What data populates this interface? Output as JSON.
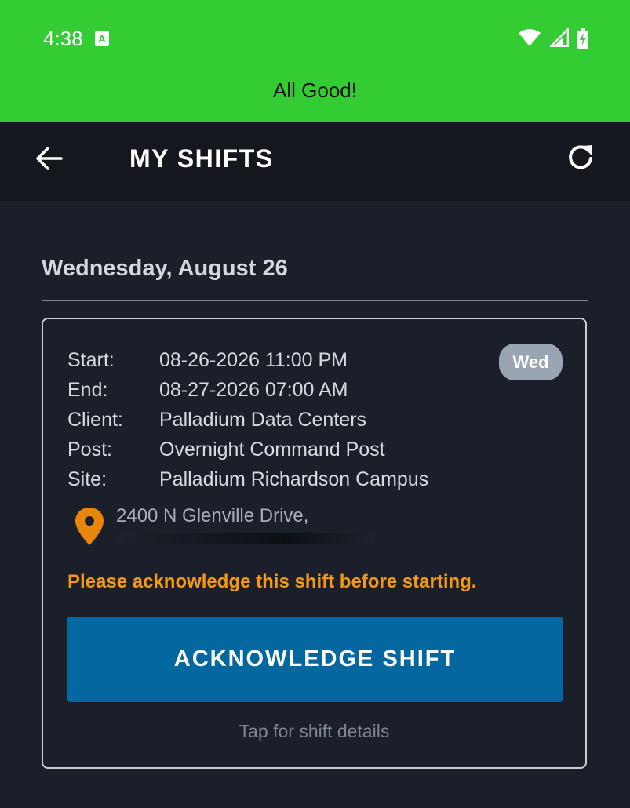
{
  "status_bar": {
    "time": "4:38",
    "app_icon_letter": "A",
    "color": "#33cc33"
  },
  "banner": {
    "text": "All Good!"
  },
  "app_bar": {
    "title": "MY SHIFTS",
    "back_icon": "arrow-left-icon",
    "refresh_icon": "refresh-icon"
  },
  "date_heading": "Wednesday, August 26",
  "shift": {
    "day_badge": "Wed",
    "fields": [
      {
        "label": "Start:",
        "value": "08-26-2026 11:00 PM"
      },
      {
        "label": "End:",
        "value": "08-27-2026 07:00 AM"
      },
      {
        "label": "Client:",
        "value": "Palladium Data Centers"
      },
      {
        "label": "Post:",
        "value": "Overnight Command Post"
      },
      {
        "label": "Site:",
        "value": "Palladium Richardson Campus"
      }
    ],
    "address": "2400 N Glenville Drive,",
    "warning": "Please acknowledge this shift before starting.",
    "acknowledge_button": "ACKNOWLEDGE SHIFT",
    "details_hint": "Tap for shift details",
    "colors": {
      "warning": "#f39a12",
      "button": "#0467a0",
      "pin": "#e8860b"
    }
  }
}
